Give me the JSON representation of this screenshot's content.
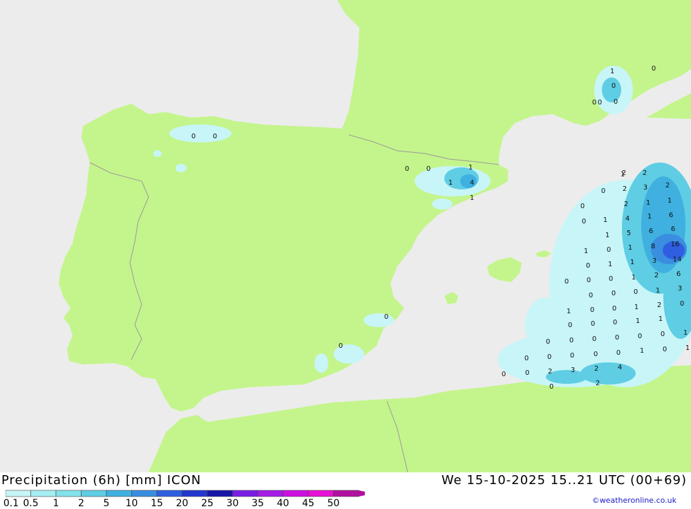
{
  "header": {
    "title": "Precipitation (6h) [mm] ICON",
    "datetime": "We 15-10-2025 15..21 UTC (00+69)",
    "credit": "©weatheronline.co.uk"
  },
  "legend": {
    "labels": [
      "0.1",
      "0.5",
      "1",
      "2",
      "5",
      "10",
      "15",
      "20",
      "25",
      "30",
      "35",
      "40",
      "45",
      "50"
    ],
    "colors": [
      "#c8f5f8",
      "#a6eef2",
      "#84e2ea",
      "#5fcde4",
      "#3fb0e0",
      "#3a8ee0",
      "#2f5fe0",
      "#2337cf",
      "#1515a8",
      "#7a1de6",
      "#a41de6",
      "#cc10e0",
      "#e70fd6",
      "#b2109e"
    ]
  },
  "map": {
    "colors": {
      "sea": "#ececec",
      "land": "#c4f58c",
      "border": "#9a9a9a"
    },
    "precip_values": [
      {
        "v": "0"
      },
      {
        "v": "0"
      },
      {
        "v": "0"
      },
      {
        "v": "0"
      },
      {
        "v": "1"
      },
      {
        "v": "1"
      },
      {
        "v": "4"
      },
      {
        "v": "1"
      },
      {
        "v": "0"
      },
      {
        "v": "0"
      },
      {
        "v": "0"
      },
      {
        "v": "1"
      },
      {
        "v": "0"
      },
      {
        "v": "0"
      },
      {
        "v": "2"
      },
      {
        "v": "1"
      },
      {
        "v": "2"
      },
      {
        "v": "0"
      },
      {
        "v": "2"
      },
      {
        "v": "3"
      },
      {
        "v": "2"
      },
      {
        "v": "0"
      },
      {
        "v": "2"
      },
      {
        "v": "1"
      },
      {
        "v": "1"
      },
      {
        "v": "0"
      },
      {
        "v": "1"
      },
      {
        "v": "4"
      },
      {
        "v": "1"
      },
      {
        "v": "6"
      },
      {
        "v": "1"
      },
      {
        "v": "5"
      },
      {
        "v": "6"
      },
      {
        "v": "6"
      },
      {
        "v": "1"
      },
      {
        "v": "0"
      },
      {
        "v": "1"
      },
      {
        "v": "8"
      },
      {
        "v": "16"
      },
      {
        "v": "0"
      },
      {
        "v": "1"
      },
      {
        "v": "1"
      },
      {
        "v": "3"
      },
      {
        "v": "14"
      },
      {
        "v": "0"
      },
      {
        "v": "0"
      },
      {
        "v": "0"
      },
      {
        "v": "1"
      },
      {
        "v": "2"
      },
      {
        "v": "6"
      },
      {
        "v": "0"
      },
      {
        "v": "0"
      },
      {
        "v": "0"
      },
      {
        "v": "1"
      },
      {
        "v": "3"
      },
      {
        "v": "1"
      },
      {
        "v": "0"
      },
      {
        "v": "0"
      },
      {
        "v": "1"
      },
      {
        "v": "2"
      },
      {
        "v": "0"
      },
      {
        "v": "0"
      },
      {
        "v": "0"
      },
      {
        "v": "0"
      },
      {
        "v": "1"
      },
      {
        "v": "1"
      },
      {
        "v": "0"
      },
      {
        "v": "0"
      },
      {
        "v": "0"
      },
      {
        "v": "0"
      },
      {
        "v": "0"
      },
      {
        "v": "0"
      },
      {
        "v": "1"
      },
      {
        "v": "0"
      },
      {
        "v": "0"
      },
      {
        "v": "0"
      },
      {
        "v": "0"
      },
      {
        "v": "0"
      },
      {
        "v": "1"
      },
      {
        "v": "0"
      },
      {
        "v": "1"
      },
      {
        "v": "0"
      },
      {
        "v": "0"
      },
      {
        "v": "2"
      },
      {
        "v": "3"
      },
      {
        "v": "2"
      },
      {
        "v": "4"
      },
      {
        "v": "0"
      },
      {
        "v": "2"
      },
      {
        "v": "0"
      },
      {
        "v": "0"
      }
    ]
  }
}
